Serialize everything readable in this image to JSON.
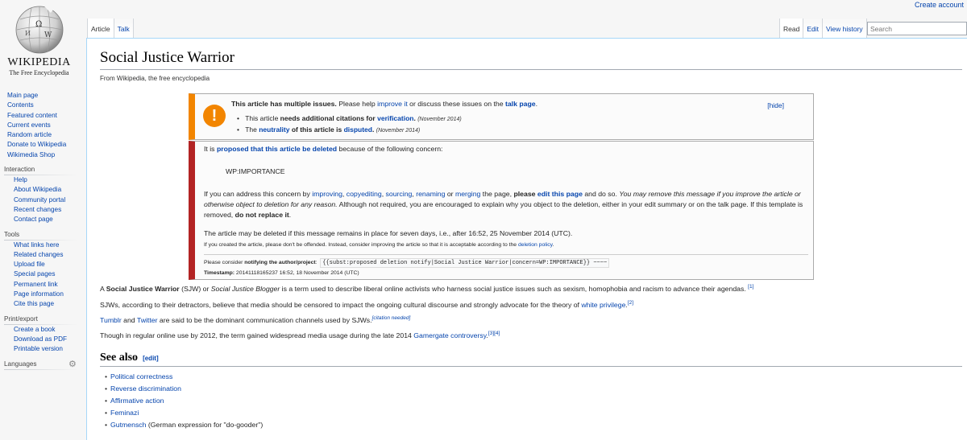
{
  "personal": {
    "create_account": "Create account"
  },
  "logo": {
    "wordmark": "WIKIPEDIA",
    "tagline": "The Free Encyclopedia"
  },
  "sidebar": {
    "navigation": [
      "Main page",
      "Contents",
      "Featured content",
      "Current events",
      "Random article",
      "Donate to Wikipedia",
      "Wikimedia Shop"
    ],
    "interaction": {
      "heading": "Interaction",
      "items": [
        "Help",
        "About Wikipedia",
        "Community portal",
        "Recent changes",
        "Contact page"
      ]
    },
    "tools": {
      "heading": "Tools",
      "items": [
        "What links here",
        "Related changes",
        "Upload file",
        "Special pages",
        "Permanent link",
        "Page information",
        "Cite this page"
      ]
    },
    "print": {
      "heading": "Print/export",
      "items": [
        "Create a book",
        "Download as PDF",
        "Printable version"
      ]
    },
    "languages": {
      "heading": "Languages"
    }
  },
  "tabs": {
    "left": [
      "Article",
      "Talk"
    ],
    "right": [
      "Read",
      "Edit",
      "View history"
    ],
    "search_placeholder": "Search"
  },
  "article": {
    "title": "Social Justice Warrior",
    "site_sub": "From Wikipedia, the free encyclopedia"
  },
  "issues_box": {
    "bold_intro": "This article has multiple issues.",
    "t1": " Please help ",
    "improve": "improve it",
    "t2": " or discuss these issues on the ",
    "talk": "talk page",
    "t3": ".",
    "hide": "[hide]",
    "i1_a": "This article ",
    "i1_b": "needs additional citations for ",
    "i1_link": "verification",
    "i1_c": ".",
    "i1_date": "(November 2014)",
    "i2_a": "The ",
    "i2_link1": "neutrality",
    "i2_b": " of this article is ",
    "i2_link2": "disputed",
    "i2_c": ".",
    "i2_date": "(November 2014)"
  },
  "delete_box": {
    "l1_a": "It is ",
    "l1_link": "proposed that this article be deleted",
    "l1_b": " because of the following concern:",
    "concern": "WP:IMPORTANCE",
    "l3_a": "If you can address this concern by ",
    "l3_improving": "improving",
    "l3_copyediting": "copyediting",
    "l3_sourcing": "sourcing",
    "l3_renaming": "renaming",
    "l3_or": " or ",
    "l3_merging": "merging",
    "l3_b": " the page, ",
    "l3_please": "please ",
    "l3_edit": "edit this page",
    "l3_c": " and do so. ",
    "l3_italic": "You may remove this message if you improve the article or otherwise",
    "l4_italic": "object to deletion for any reason.",
    "l4_b": " Although not required, you are encouraged to explain why you object to the deletion, either in your edit summary or on the talk page. If this template is removed, ",
    "l4_bold": "do not",
    "l5_bold": "replace it",
    "l5_end": ".",
    "l6": "The article may be deleted if this message remains in place for seven days, i.e., after 16:52, 25 November 2014 (UTC).",
    "l7_a": "If you created the article, please don't be offended. Instead, consider improving the article so that it is acceptable according to the ",
    "l7_link": "deletion policy",
    "l7_b": ".",
    "l8_a": "Please consider ",
    "l8_bold": "notifying the author/project",
    "l8_b": ":",
    "l8_code": "{{subst:proposed deletion notify|Social Justice Warrior|concern=WP:IMPORTANCE}} ~~~~",
    "l9_bold": "Timestamp:",
    "l9_text": " 20141118165237 16:52, 18 November 2014 (UTC)"
  },
  "body": {
    "p1_a": "A ",
    "p1_bold": "Social Justice Warrior",
    "p1_b": " (SJW) or ",
    "p1_it": "Social Justice Blogger",
    "p1_c": " is a term used to describe liberal online activists who harness social justice issues such as sexism, homophobia and racism to advance their agendas.",
    "p1_ref": "[1]",
    "p2_a": "SJWs, according to their detractors, believe that media should be censored to impact the ongoing cultural discourse and strongly advocate for the theory of ",
    "p2_link": "white privilege",
    "p2_b": ".",
    "p2_ref": "[2]",
    "p3_link1": "Tumblr",
    "p3_a": " and ",
    "p3_link2": "Twitter",
    "p3_b": " are said to be the dominant communication channels used by SJWs.",
    "p3_ref": "[citation needed]",
    "p4_a": "Though in regular online use by 2012, the term gained widespread media usage during the late 2014 ",
    "p4_link": "Gamergate controversy",
    "p4_b": ".",
    "p4_ref": "[3][4]"
  },
  "see_also": {
    "heading": "See also",
    "edit": "[edit]",
    "items": [
      "Political correctness",
      "Reverse discrimination",
      "Affirmative action",
      "Feminazi",
      "Gutmensch"
    ],
    "gutmensch_note": " (German expression for \"do-gooder\")"
  }
}
